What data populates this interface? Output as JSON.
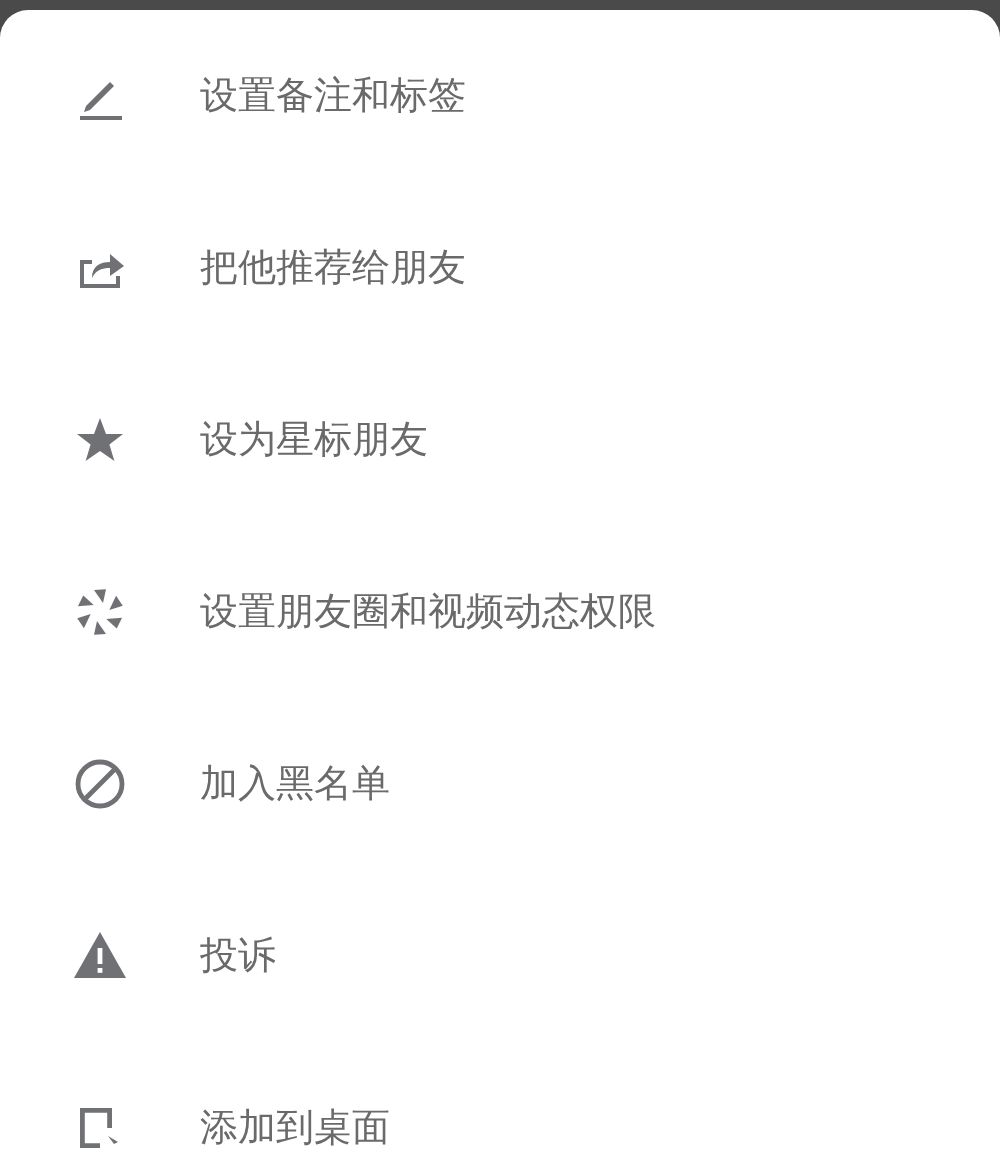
{
  "menu": {
    "items": [
      {
        "label": "设置备注和标签",
        "kind": "edit"
      },
      {
        "label": "把他推荐给朋友",
        "kind": "share"
      },
      {
        "label": "设为星标朋友",
        "kind": "star"
      },
      {
        "label": "设置朋友圈和视频动态权限",
        "kind": "aperture"
      },
      {
        "label": "加入黑名单",
        "kind": "block"
      },
      {
        "label": "投诉",
        "kind": "warning"
      },
      {
        "label": "添加到桌面",
        "kind": "desktop"
      }
    ]
  }
}
